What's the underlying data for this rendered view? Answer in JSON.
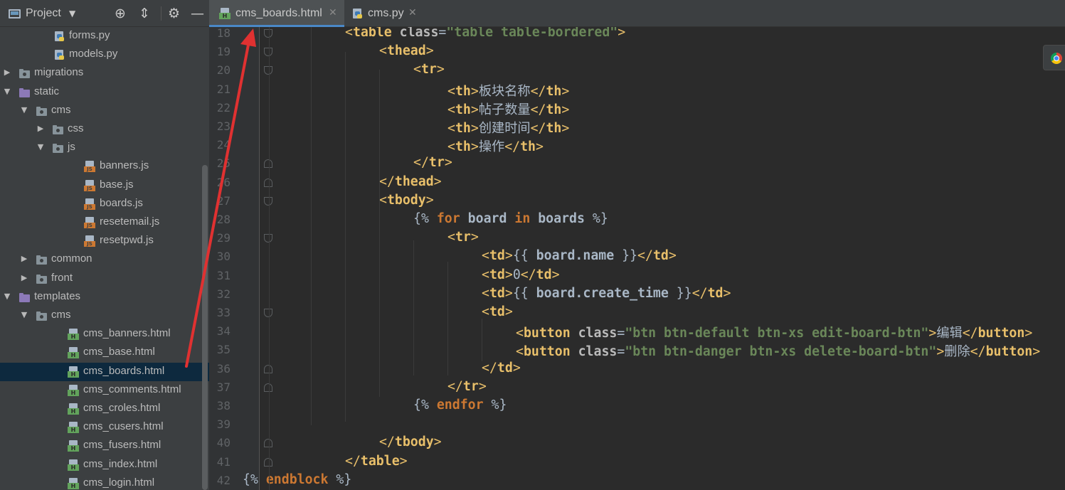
{
  "project_panel": {
    "title": "Project",
    "icons": [
      "locate-icon",
      "collapse-all-icon",
      "gear-icon",
      "hide-icon"
    ],
    "tree": [
      {
        "label": "forms.py",
        "type": "py"
      },
      {
        "label": "models.py",
        "type": "py"
      },
      {
        "label": "migrations",
        "type": "folder",
        "expanded": false
      },
      {
        "label": "static",
        "type": "pfolder",
        "expanded": true
      },
      {
        "label": "cms",
        "type": "folder",
        "expanded": true
      },
      {
        "label": "css",
        "type": "folder",
        "expanded": false
      },
      {
        "label": "js",
        "type": "folder",
        "expanded": true
      },
      {
        "label": "banners.js",
        "type": "js"
      },
      {
        "label": "base.js",
        "type": "js"
      },
      {
        "label": "boards.js",
        "type": "js"
      },
      {
        "label": "resetemail.js",
        "type": "js"
      },
      {
        "label": "resetpwd.js",
        "type": "js"
      },
      {
        "label": "common",
        "type": "folder",
        "expanded": false
      },
      {
        "label": "front",
        "type": "folder",
        "expanded": false
      },
      {
        "label": "templates",
        "type": "pfolder",
        "expanded": true
      },
      {
        "label": "cms",
        "type": "folder",
        "expanded": true
      },
      {
        "label": "cms_banners.html",
        "type": "html"
      },
      {
        "label": "cms_base.html",
        "type": "html"
      },
      {
        "label": "cms_boards.html",
        "type": "html",
        "selected": true
      },
      {
        "label": "cms_comments.html",
        "type": "html"
      },
      {
        "label": "cms_croles.html",
        "type": "html"
      },
      {
        "label": "cms_cusers.html",
        "type": "html"
      },
      {
        "label": "cms_fusers.html",
        "type": "html"
      },
      {
        "label": "cms_index.html",
        "type": "html"
      },
      {
        "label": "cms_login.html",
        "type": "html"
      }
    ]
  },
  "tabs": [
    {
      "label": "cms_boards.html",
      "type": "html",
      "active": true
    },
    {
      "label": "cms.py",
      "type": "py",
      "active": false
    }
  ],
  "editor": {
    "lines": [
      {
        "n": "18",
        "tokens": [
          [
            "br",
            "<"
          ],
          [
            "tg",
            "table "
          ],
          [
            "at",
            "class"
          ],
          [
            "dl",
            "="
          ],
          [
            "st",
            "\"table table-bordered\""
          ],
          [
            "br",
            ">"
          ]
        ]
      },
      {
        "n": "19",
        "tokens": [
          [
            "br",
            "<"
          ],
          [
            "tg",
            "thead"
          ],
          [
            "br",
            ">"
          ]
        ]
      },
      {
        "n": "20",
        "tokens": [
          [
            "br",
            "<"
          ],
          [
            "tg",
            "tr"
          ],
          [
            "br",
            ">"
          ]
        ]
      },
      {
        "n": "21",
        "tokens": [
          [
            "br",
            "<"
          ],
          [
            "tg",
            "th"
          ],
          [
            "br",
            ">"
          ],
          [
            "tx",
            "板块名称"
          ],
          [
            "br",
            "</"
          ],
          [
            "tg",
            "th"
          ],
          [
            "br",
            ">"
          ]
        ]
      },
      {
        "n": "22",
        "tokens": [
          [
            "br",
            "<"
          ],
          [
            "tg",
            "th"
          ],
          [
            "br",
            ">"
          ],
          [
            "tx",
            "帖子数量"
          ],
          [
            "br",
            "</"
          ],
          [
            "tg",
            "th"
          ],
          [
            "br",
            ">"
          ]
        ]
      },
      {
        "n": "23",
        "tokens": [
          [
            "br",
            "<"
          ],
          [
            "tg",
            "th"
          ],
          [
            "br",
            ">"
          ],
          [
            "tx",
            "创建时间"
          ],
          [
            "br",
            "</"
          ],
          [
            "tg",
            "th"
          ],
          [
            "br",
            ">"
          ]
        ]
      },
      {
        "n": "24",
        "tokens": [
          [
            "br",
            "<"
          ],
          [
            "tg",
            "th"
          ],
          [
            "br",
            ">"
          ],
          [
            "tx",
            "操作"
          ],
          [
            "br",
            "</"
          ],
          [
            "tg",
            "th"
          ],
          [
            "br",
            ">"
          ]
        ]
      },
      {
        "n": "25",
        "tokens": [
          [
            "br",
            "</"
          ],
          [
            "tg",
            "tr"
          ],
          [
            "br",
            ">"
          ]
        ]
      },
      {
        "n": "26",
        "tokens": [
          [
            "br",
            "</"
          ],
          [
            "tg",
            "thead"
          ],
          [
            "br",
            ">"
          ]
        ]
      },
      {
        "n": "27",
        "tokens": [
          [
            "br",
            "<"
          ],
          [
            "tg",
            "tbody"
          ],
          [
            "br",
            ">"
          ]
        ]
      },
      {
        "n": "28",
        "tokens": [
          [
            "dl",
            "{% "
          ],
          [
            "kw",
            "for"
          ],
          [
            "tpl",
            " board "
          ],
          [
            "kw",
            "in"
          ],
          [
            "tpl",
            " boards "
          ],
          [
            "dl",
            "%}"
          ]
        ]
      },
      {
        "n": "29",
        "tokens": [
          [
            "br",
            "<"
          ],
          [
            "tg",
            "tr"
          ],
          [
            "br",
            ">"
          ]
        ]
      },
      {
        "n": "30",
        "tokens": [
          [
            "br",
            "<"
          ],
          [
            "tg",
            "td"
          ],
          [
            "br",
            ">"
          ],
          [
            "dl",
            "{{ "
          ],
          [
            "tpl",
            "board.name"
          ],
          [
            "dl",
            " }}"
          ],
          [
            "br",
            "</"
          ],
          [
            "tg",
            "td"
          ],
          [
            "br",
            ">"
          ]
        ]
      },
      {
        "n": "31",
        "tokens": [
          [
            "br",
            "<"
          ],
          [
            "tg",
            "td"
          ],
          [
            "br",
            ">"
          ],
          [
            "tx",
            "0"
          ],
          [
            "br",
            "</"
          ],
          [
            "tg",
            "td"
          ],
          [
            "br",
            ">"
          ]
        ]
      },
      {
        "n": "32",
        "tokens": [
          [
            "br",
            "<"
          ],
          [
            "tg",
            "td"
          ],
          [
            "br",
            ">"
          ],
          [
            "dl",
            "{{ "
          ],
          [
            "tpl",
            "board.create_time"
          ],
          [
            "dl",
            " }}"
          ],
          [
            "br",
            "</"
          ],
          [
            "tg",
            "td"
          ],
          [
            "br",
            ">"
          ]
        ]
      },
      {
        "n": "33",
        "tokens": [
          [
            "br",
            "<"
          ],
          [
            "tg",
            "td"
          ],
          [
            "br",
            ">"
          ]
        ]
      },
      {
        "n": "34",
        "tokens": [
          [
            "br",
            "<"
          ],
          [
            "tg",
            "button "
          ],
          [
            "at",
            "class"
          ],
          [
            "dl",
            "="
          ],
          [
            "st",
            "\"btn btn-default btn-xs edit-board-btn\""
          ],
          [
            "br",
            ">"
          ],
          [
            "tx",
            "编辑"
          ],
          [
            "br",
            "</"
          ],
          [
            "tg",
            "button"
          ],
          [
            "br",
            ">"
          ]
        ]
      },
      {
        "n": "35",
        "tokens": [
          [
            "br",
            "<"
          ],
          [
            "tg",
            "button "
          ],
          [
            "at",
            "class"
          ],
          [
            "dl",
            "="
          ],
          [
            "st",
            "\"btn btn-danger btn-xs delete-board-btn\""
          ],
          [
            "br",
            ">"
          ],
          [
            "tx",
            "删除"
          ],
          [
            "br",
            "</"
          ],
          [
            "tg",
            "button"
          ],
          [
            "br",
            ">"
          ]
        ]
      },
      {
        "n": "36",
        "tokens": [
          [
            "br",
            "</"
          ],
          [
            "tg",
            "td"
          ],
          [
            "br",
            ">"
          ]
        ]
      },
      {
        "n": "37",
        "tokens": [
          [
            "br",
            "</"
          ],
          [
            "tg",
            "tr"
          ],
          [
            "br",
            ">"
          ]
        ]
      },
      {
        "n": "38",
        "tokens": [
          [
            "dl",
            "{% "
          ],
          [
            "kw",
            "endfor"
          ],
          [
            "dl",
            " %}"
          ]
        ]
      },
      {
        "n": "39",
        "tokens": []
      },
      {
        "n": "40",
        "tokens": [
          [
            "br",
            "</"
          ],
          [
            "tg",
            "tbody"
          ],
          [
            "br",
            ">"
          ]
        ]
      },
      {
        "n": "41",
        "tokens": [
          [
            "br",
            "</"
          ],
          [
            "tg",
            "table"
          ],
          [
            "br",
            ">"
          ]
        ]
      },
      {
        "n": "42",
        "tokens": [
          [
            "dl",
            "{% "
          ],
          [
            "kw",
            "endblock"
          ],
          [
            "dl",
            " %}"
          ]
        ]
      }
    ]
  },
  "annotation": {
    "color": "#e03131",
    "kind": "red arrow pointing to active tab"
  }
}
